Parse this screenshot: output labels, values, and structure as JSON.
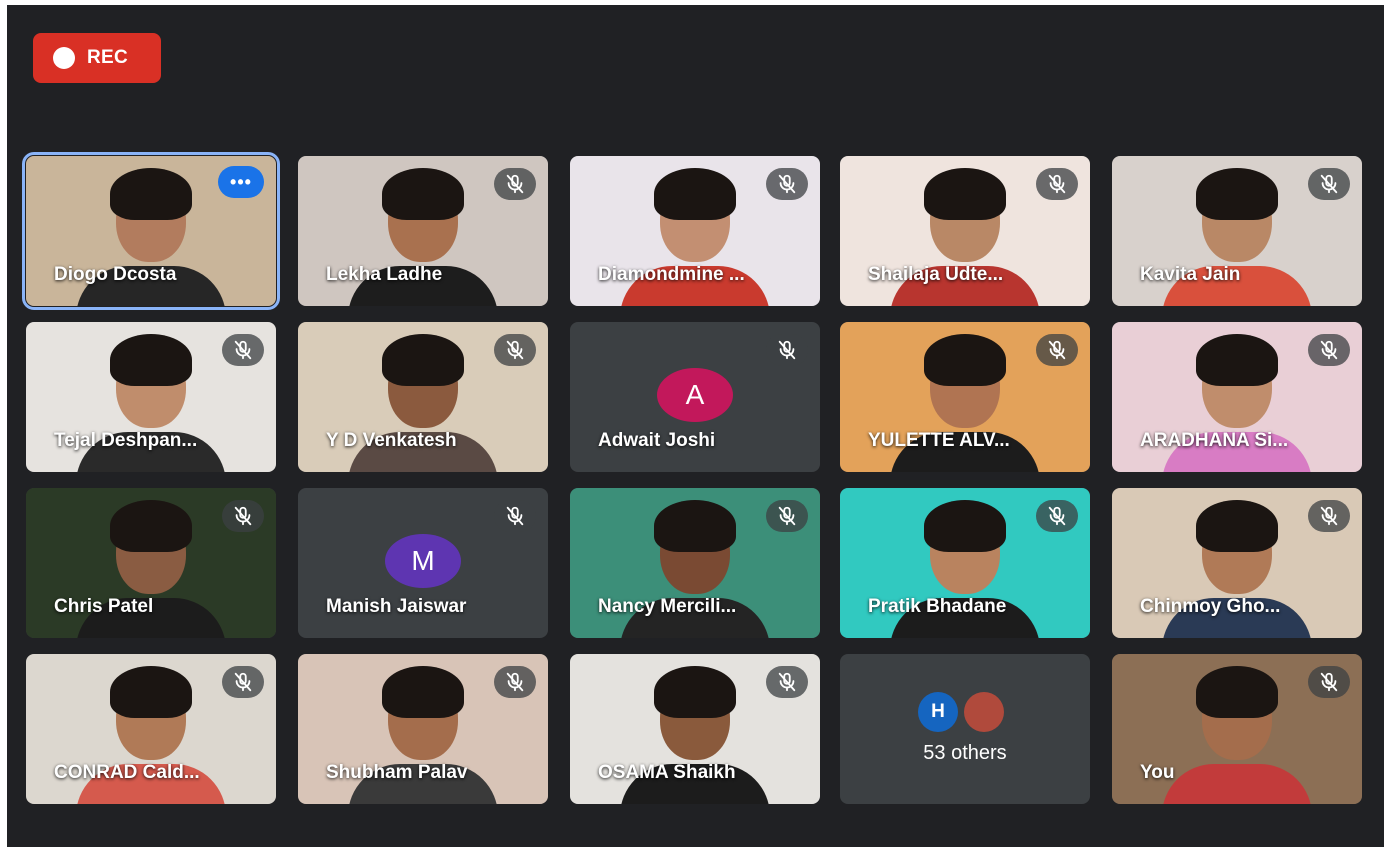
{
  "recording": {
    "label": "REC"
  },
  "tiles": [
    {
      "name": "Diogo Dcosta",
      "active": true,
      "more_label": "•••",
      "bg": "#c9b59a",
      "skin": "#b27c5e",
      "shirt": "#262626"
    },
    {
      "name": "Lekha Ladhe",
      "muted": true,
      "bg": "#cfc6c0",
      "skin": "#a9714f",
      "shirt": "#1d1d1d"
    },
    {
      "name": "Diamondmine ...",
      "muted": true,
      "bg": "#e9e4ea",
      "skin": "#c38f72",
      "shirt": "#c93a2e"
    },
    {
      "name": "Shailaja Udte...",
      "muted": true,
      "bg": "#efe4de",
      "skin": "#b98866",
      "shirt": "#b8352f"
    },
    {
      "name": "Kavita Jain",
      "muted": true,
      "bg": "#d8d1cc",
      "skin": "#b98866",
      "shirt": "#d9503c"
    },
    {
      "name": "Tejal Deshpan...",
      "muted": true,
      "bg": "#e6e3df",
      "skin": "#c08d6c",
      "shirt": "#2a2a2a"
    },
    {
      "name": "Y D Venkatesh",
      "muted": true,
      "bg": "#d9ccb9",
      "skin": "#8b5a3e",
      "shirt": "#5a4a44"
    },
    {
      "name": "Adwait Joshi",
      "muted": true,
      "avatar_letter": "A",
      "avatar_color": "#c2185b"
    },
    {
      "name": "YULETTE ALV...",
      "muted": true,
      "bg": "#e3a25a",
      "skin": "#b07452",
      "shirt": "#1c1c1c"
    },
    {
      "name": "ARADHANA Si...",
      "muted": true,
      "bg": "#e9cfd6",
      "skin": "#c08d6c",
      "shirt": "#d87cc4"
    },
    {
      "name": "Chris Patel",
      "muted": true,
      "bg": "#2b3a26",
      "skin": "#8a5c42",
      "shirt": "#1c1c1c"
    },
    {
      "name": "Manish Jaiswar",
      "muted": true,
      "avatar_letter": "M",
      "avatar_color": "#5e35b1"
    },
    {
      "name": "Nancy Mercili...",
      "muted": true,
      "bg": "#3c8f79",
      "skin": "#7a4a33",
      "shirt": "#242424"
    },
    {
      "name": "Pratik Bhadane",
      "muted": true,
      "bg": "#31c9c0",
      "skin": "#b9835f",
      "shirt": "#1c1c1c"
    },
    {
      "name": "Chinmoy Gho...",
      "muted": true,
      "bg": "#d9c9b6",
      "skin": "#b07a57",
      "shirt": "#2a3a55"
    },
    {
      "name": "CONRAD Cald...",
      "muted": true,
      "bg": "#dcd7cf",
      "skin": "#b07a57",
      "shirt": "#d55a4d"
    },
    {
      "name": "Shubham Palav",
      "muted": true,
      "bg": "#d8c4b7",
      "skin": "#a46d4c",
      "shirt": "#3a3a3a"
    },
    {
      "name": "OSAMA Shaikh",
      "muted": true,
      "bg": "#e4e2de",
      "skin": "#8a5a3c",
      "shirt": "#1c1c1c"
    },
    {
      "name": "53 others",
      "others": true,
      "mini_letter": "H",
      "mini_color": "#1565c0",
      "mini_photo_color": "#b04a3c"
    },
    {
      "name": "You",
      "muted": true,
      "bg": "#8c6f55",
      "skin": "#a46d4c",
      "shirt": "#c23b3b"
    }
  ]
}
